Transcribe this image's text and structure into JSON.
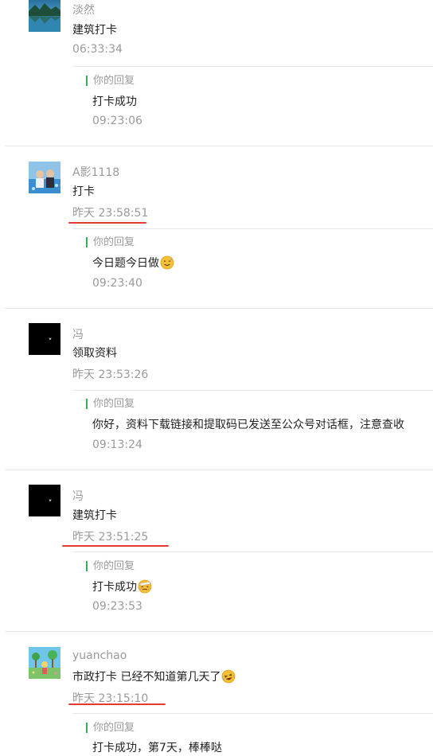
{
  "messages": [
    {
      "username": "淡然",
      "avatar": "landscape-avatar",
      "content": "建筑打卡",
      "time": "06:33:34",
      "reply_label": "你的回复",
      "reply": "打卡成功",
      "reply_time": "09:23:06"
    },
    {
      "username": "A影1118",
      "avatar": "photo-avatar",
      "content": "打卡",
      "time": "昨天 23:58:51",
      "reply_label": "你的回复",
      "reply": "今日题今日做",
      "reply_emoji": "sweat-smile-emoji",
      "reply_time": "09:23:40"
    },
    {
      "username": "冯",
      "avatar": "black-avatar",
      "content": "领取资料",
      "time": "昨天 23:53:26",
      "reply_label": "你的回复",
      "reply": "你好，资料下载链接和提取码已发送至公众号对话框，注意查收",
      "reply_time": "09:13:24"
    },
    {
      "username": "冯",
      "avatar": "black-avatar",
      "content": "建筑打卡",
      "time": "昨天 23:51:25",
      "reply_label": "你的回复",
      "reply": "打卡成功",
      "reply_emoji": "bandage-face-emoji",
      "reply_time": "09:23:53"
    },
    {
      "username": "yuanchao",
      "avatar": "cartoon-avatar",
      "content": "市政打卡 已经不知道第几天了",
      "content_emoji": "laughing-tears-emoji",
      "time": "昨天 23:15:10",
      "reply_label": "你的回复",
      "reply": "打卡成功，第7天，棒棒哒"
    }
  ],
  "colors": {
    "reply_accent": "#2db35a",
    "highlight_underline": "#e53935",
    "meta_text": "#9a9a9a"
  }
}
